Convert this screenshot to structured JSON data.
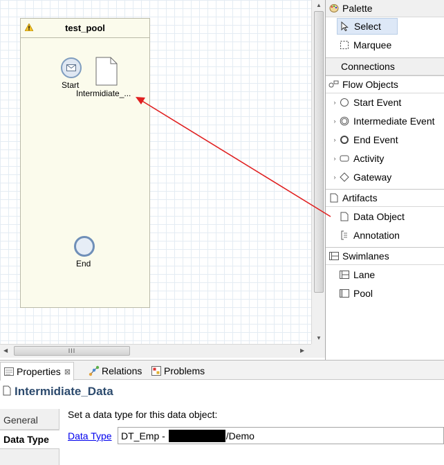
{
  "canvas": {
    "pool": {
      "title": "test_pool"
    },
    "start_event": {
      "label": "Start"
    },
    "data_object": {
      "label": "Intermidiate_..."
    },
    "end_event": {
      "label": "End"
    },
    "hscroll_grip": "III"
  },
  "palette": {
    "header": "Palette",
    "tools": [
      {
        "label": "Select",
        "icon": "arrow-pointer-icon",
        "selected": true
      },
      {
        "label": "Marquee",
        "icon": "marquee-icon"
      }
    ],
    "sections": {
      "connections": "Connections",
      "flow_objects": "Flow Objects",
      "artifacts": "Artifacts",
      "swimlanes": "Swimlanes"
    },
    "flow_items": [
      {
        "label": "Start Event",
        "icon": "circle-icon"
      },
      {
        "label": "Intermediate Event",
        "icon": "double-circle-icon"
      },
      {
        "label": "End Event",
        "icon": "thick-circle-icon"
      },
      {
        "label": "Activity",
        "icon": "rounded-rect-icon"
      },
      {
        "label": "Gateway",
        "icon": "diamond-icon"
      }
    ],
    "artifact_items": [
      {
        "label": "Data Object",
        "icon": "document-icon"
      },
      {
        "label": "Annotation",
        "icon": "annotation-icon"
      }
    ],
    "swimlane_items": [
      {
        "label": "Lane",
        "icon": "lane-icon"
      },
      {
        "label": "Pool",
        "icon": "pool-icon"
      }
    ]
  },
  "bottom": {
    "tabs": {
      "properties": "Properties",
      "close": "⊠",
      "relations": "Relations",
      "problems": "Problems"
    },
    "title": "Intermidiate_Data",
    "side_tabs": {
      "general": "General",
      "data_type": "Data Type"
    },
    "description": "Set a data type for this data object:",
    "field_label": "Data Type",
    "field_value_prefix": "DT_Emp - ",
    "field_value_suffix": "/Demo"
  },
  "colors": {
    "pool_fill": "#fbfbec",
    "event_stroke": "#6f8fb8",
    "title_color": "#2c4a6d",
    "arrow": "#e02020",
    "selection": "#dde8f7"
  }
}
